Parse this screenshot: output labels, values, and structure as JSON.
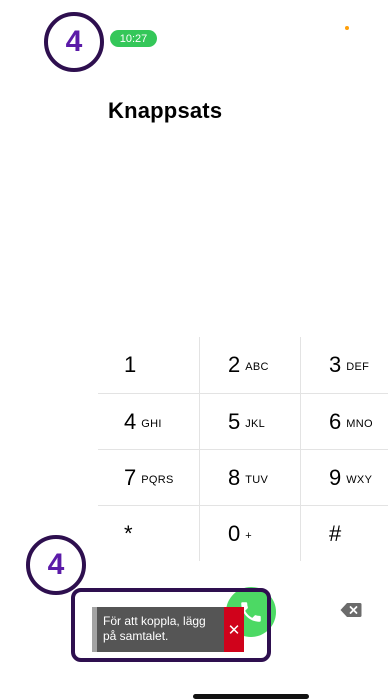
{
  "status_bar": {
    "time": "10:27"
  },
  "step_badges": {
    "top": "4",
    "bottom": "4"
  },
  "page": {
    "title": "Knappsats"
  },
  "keypad": {
    "rows": [
      [
        {
          "digit": "1",
          "letters": ""
        },
        {
          "digit": "2",
          "letters": "ABC"
        },
        {
          "digit": "3",
          "letters": "DEF"
        }
      ],
      [
        {
          "digit": "4",
          "letters": "GHI"
        },
        {
          "digit": "5",
          "letters": "JKL"
        },
        {
          "digit": "6",
          "letters": "MNO"
        }
      ],
      [
        {
          "digit": "7",
          "letters": "PQRS"
        },
        {
          "digit": "8",
          "letters": "TUV"
        },
        {
          "digit": "9",
          "letters": "WXY"
        }
      ],
      [
        {
          "digit": "*",
          "letters": ""
        },
        {
          "digit": "0",
          "letters": "+"
        },
        {
          "digit": "#",
          "letters": ""
        }
      ]
    ]
  },
  "toast": {
    "message": "För att koppla, lägg på samtalet.",
    "close_icon": "close-icon"
  },
  "icons": {
    "call": "phone-icon",
    "backspace": "backspace-icon"
  },
  "colors": {
    "accent_purple": "#5b1aa8",
    "frame": "#2e0f4f",
    "time_green": "#34c759",
    "call_green": "#4cd964",
    "toast_bg": "#555555",
    "toast_close": "#d0021b"
  }
}
